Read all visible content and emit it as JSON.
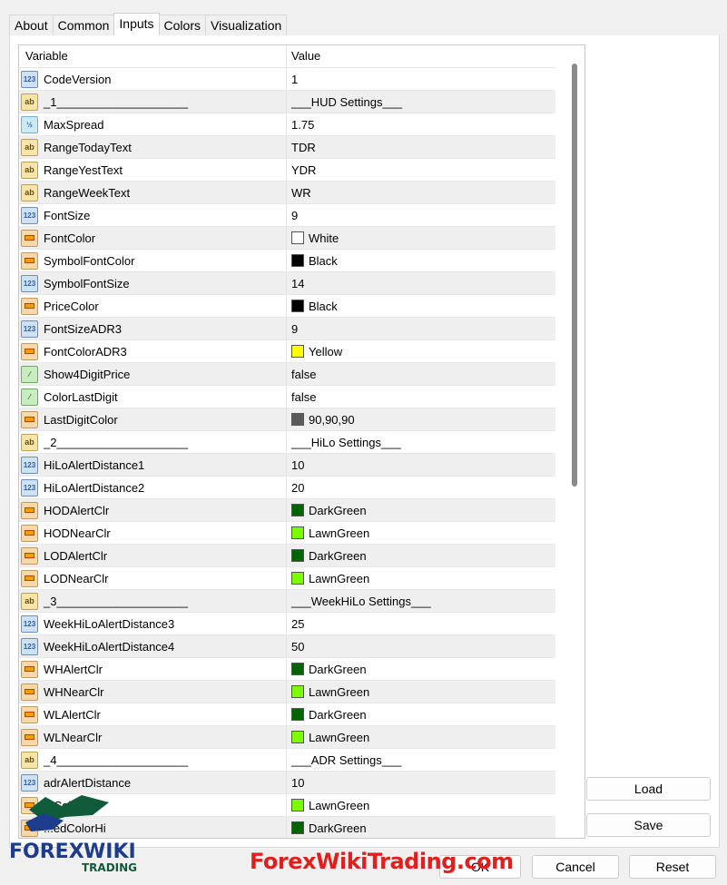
{
  "tabs": [
    "About",
    "Common",
    "Inputs",
    "Colors",
    "Visualization"
  ],
  "active_tab": "Inputs",
  "table": {
    "col_variable": "Variable",
    "col_value": "Value",
    "rows": [
      {
        "icon": "num",
        "name": "CodeVersion",
        "value": "1"
      },
      {
        "icon": "txt",
        "name": "_1____________________",
        "value": "___HUD Settings___"
      },
      {
        "icon": "dbl",
        "name": "MaxSpread",
        "value": "1.75"
      },
      {
        "icon": "txt",
        "name": "RangeTodayText",
        "value": "TDR"
      },
      {
        "icon": "txt",
        "name": "RangeYestText",
        "value": "YDR"
      },
      {
        "icon": "txt",
        "name": "RangeWeekText",
        "value": "WR"
      },
      {
        "icon": "num",
        "name": "FontSize",
        "value": "9"
      },
      {
        "icon": "clr",
        "name": "FontColor",
        "value": "White",
        "swatch": "#ffffff"
      },
      {
        "icon": "clr",
        "name": "SymbolFontColor",
        "value": "Black",
        "swatch": "#000000"
      },
      {
        "icon": "num",
        "name": "SymbolFontSize",
        "value": "14"
      },
      {
        "icon": "clr",
        "name": "PriceColor",
        "value": "Black",
        "swatch": "#000000"
      },
      {
        "icon": "num",
        "name": "FontSizeADR3",
        "value": "9"
      },
      {
        "icon": "clr",
        "name": "FontColorADR3",
        "value": "Yellow",
        "swatch": "#ffff00"
      },
      {
        "icon": "bool",
        "name": "Show4DigitPrice",
        "value": "false"
      },
      {
        "icon": "bool",
        "name": "ColorLastDigit",
        "value": "false"
      },
      {
        "icon": "clr",
        "name": "LastDigitColor",
        "value": "90,90,90",
        "swatch": "#5a5a5a"
      },
      {
        "icon": "txt",
        "name": "_2____________________",
        "value": "___HiLo Settings___"
      },
      {
        "icon": "num",
        "name": "HiLoAlertDistance1",
        "value": "10"
      },
      {
        "icon": "num",
        "name": "HiLoAlertDistance2",
        "value": "20"
      },
      {
        "icon": "clr",
        "name": "HODAlertClr",
        "value": "DarkGreen",
        "swatch": "#006400"
      },
      {
        "icon": "clr",
        "name": "HODNearClr",
        "value": "LawnGreen",
        "swatch": "#7cfc00"
      },
      {
        "icon": "clr",
        "name": "LODAlertClr",
        "value": "DarkGreen",
        "swatch": "#006400"
      },
      {
        "icon": "clr",
        "name": "LODNearClr",
        "value": "LawnGreen",
        "swatch": "#7cfc00"
      },
      {
        "icon": "txt",
        "name": "_3____________________",
        "value": "___WeekHiLo Settings___"
      },
      {
        "icon": "num",
        "name": "WeekHiLoAlertDistance3",
        "value": "25"
      },
      {
        "icon": "num",
        "name": "WeekHiLoAlertDistance4",
        "value": "50"
      },
      {
        "icon": "clr",
        "name": "WHAlertClr",
        "value": "DarkGreen",
        "swatch": "#006400"
      },
      {
        "icon": "clr",
        "name": "WHNearClr",
        "value": "LawnGreen",
        "swatch": "#7cfc00"
      },
      {
        "icon": "clr",
        "name": "WLAlertClr",
        "value": "DarkGreen",
        "swatch": "#006400"
      },
      {
        "icon": "clr",
        "name": "WLNearClr",
        "value": "LawnGreen",
        "swatch": "#7cfc00"
      },
      {
        "icon": "txt",
        "name": "_4____________________",
        "value": "___ADR Settings___"
      },
      {
        "icon": "num",
        "name": "adrAlertDistance",
        "value": "10"
      },
      {
        "icon": "clr",
        "name": "...ColorHi",
        "value": "LawnGreen",
        "swatch": "#7cfc00"
      },
      {
        "icon": "clr",
        "name": "...edColorHi",
        "value": "DarkGreen",
        "swatch": "#006400"
      }
    ]
  },
  "buttons": {
    "load": "Load",
    "save": "Save",
    "ok": "OK",
    "cancel": "Cancel",
    "reset": "Reset"
  },
  "logo": {
    "line1_a": "FOREX",
    "line1_b": "WIKI",
    "line2": "TRADING"
  },
  "watermark": "ForexWikiTrading.com"
}
